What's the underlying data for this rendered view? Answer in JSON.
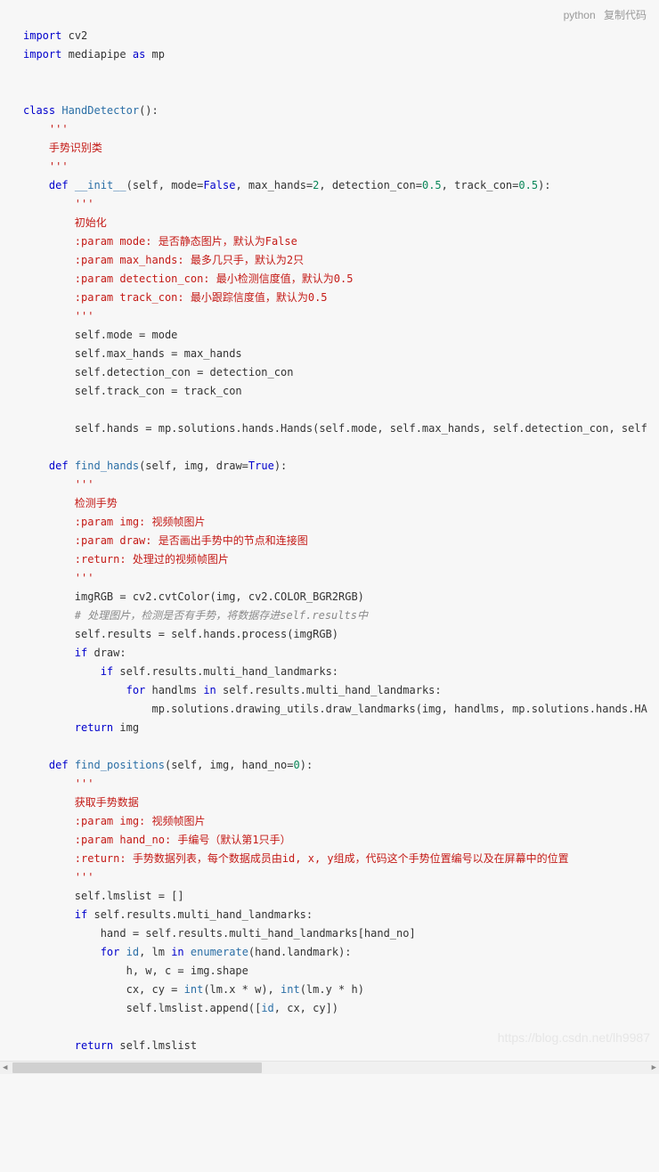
{
  "header": {
    "lang": "python",
    "copy": "复制代码"
  },
  "code": {
    "l1_kw": "import",
    "l1_mod": "cv2",
    "l2_kw": "import",
    "l2_mod": "mediapipe",
    "l2_as": "as",
    "l2_alias": "mp",
    "l3_kw": "class",
    "l3_name": "HandDetector",
    "l3_doc1": "'''",
    "l3_doc2": "手势识别类",
    "l3_doc3": "'''",
    "init_kw": "def",
    "init_name": "__init__",
    "init_sig1": "(self, mode=",
    "init_false": "False",
    "init_sig2": ", max_hands=",
    "init_2": "2",
    "init_sig3": ", detection_con=",
    "init_05a": "0.5",
    "init_sig4": ", track_con=",
    "init_05b": "0.5",
    "init_sig5": "):",
    "init_d1": "'''",
    "init_d2": "初始化",
    "init_d3": ":param mode: 是否静态图片，默认为False",
    "init_d4": ":param max_hands: 最多几只手，默认为2只",
    "init_d5": ":param detection_con: 最小检测信度值，默认为0.5",
    "init_d6": ":param track_con: 最小跟踪信度值，默认为0.5",
    "init_d7": "'''",
    "init_b1": "self.mode = mode",
    "init_b2": "self.max_hands = max_hands",
    "init_b3": "self.detection_con = detection_con",
    "init_b4": "self.track_con = track_con",
    "init_b5": "self.hands = mp.solutions.hands.Hands(self.mode, self.max_hands, self.detection_con, self",
    "fh_kw": "def",
    "fh_name": "find_hands",
    "fh_sig1": "(self, img, draw=",
    "fh_true": "True",
    "fh_sig2": "):",
    "fh_d1": "'''",
    "fh_d2": "检测手势",
    "fh_d3": ":param img: 视频帧图片",
    "fh_d4": ":param draw: 是否画出手势中的节点和连接图",
    "fh_d5": ":return: 处理过的视频帧图片",
    "fh_d6": "'''",
    "fh_b1": "imgRGB = cv2.cvtColor(img, cv2.COLOR_BGR2RGB)",
    "fh_c1": "# 处理图片，检测是否有手势，将数据存进self.results中",
    "fh_b2": "self.results = self.hands.process(imgRGB)",
    "fh_b3_if": "if",
    "fh_b3_rest": " draw:",
    "fh_b4_if": "if",
    "fh_b4_rest": " self.results.multi_hand_landmarks:",
    "fh_b5_for": "for",
    "fh_b5_a": " handlms ",
    "fh_b5_in": "in",
    "fh_b5_b": " self.results.multi_hand_landmarks:",
    "fh_b6": "mp.solutions.drawing_utils.draw_landmarks(img, handlms, mp.solutions.hands.HA",
    "fh_ret_kw": "return",
    "fh_ret_v": " img",
    "fp_kw": "def",
    "fp_name": "find_positions",
    "fp_sig1": "(self, img, hand_no=",
    "fp_0": "0",
    "fp_sig2": "):",
    "fp_d1": "'''",
    "fp_d2": "获取手势数据",
    "fp_d3": ":param img: 视频帧图片",
    "fp_d4": ":param hand_no: 手编号（默认第1只手）",
    "fp_d5": ":return: 手势数据列表，每个数据成员由id, x, y组成，代码这个手势位置编号以及在屏幕中的位置",
    "fp_d6": "'''",
    "fp_b1": "self.lmslist = []",
    "fp_b2_if": "if",
    "fp_b2_rest": " self.results.multi_hand_landmarks:",
    "fp_b3": "hand = self.results.multi_hand_landmarks[hand_no]",
    "fp_b4_for": "for",
    "fp_b4_a": " ",
    "fp_b4_id": "id",
    "fp_b4_b": ", lm ",
    "fp_b4_in": "in",
    "fp_b4_c": " ",
    "fp_b4_enum": "enumerate",
    "fp_b4_d": "(hand.landmark):",
    "fp_b5": "h, w, c = img.shape",
    "fp_b6a": "cx, cy = ",
    "fp_b6_int1": "int",
    "fp_b6b": "(lm.x * w), ",
    "fp_b6_int2": "int",
    "fp_b6c": "(lm.y * h)",
    "fp_b7a": "self.lmslist.append([",
    "fp_b7_id": "id",
    "fp_b7b": ", cx, cy])",
    "fp_ret_kw": "return",
    "fp_ret_v": " self.lmslist"
  },
  "watermark": "https://blog.csdn.net/lh9987"
}
